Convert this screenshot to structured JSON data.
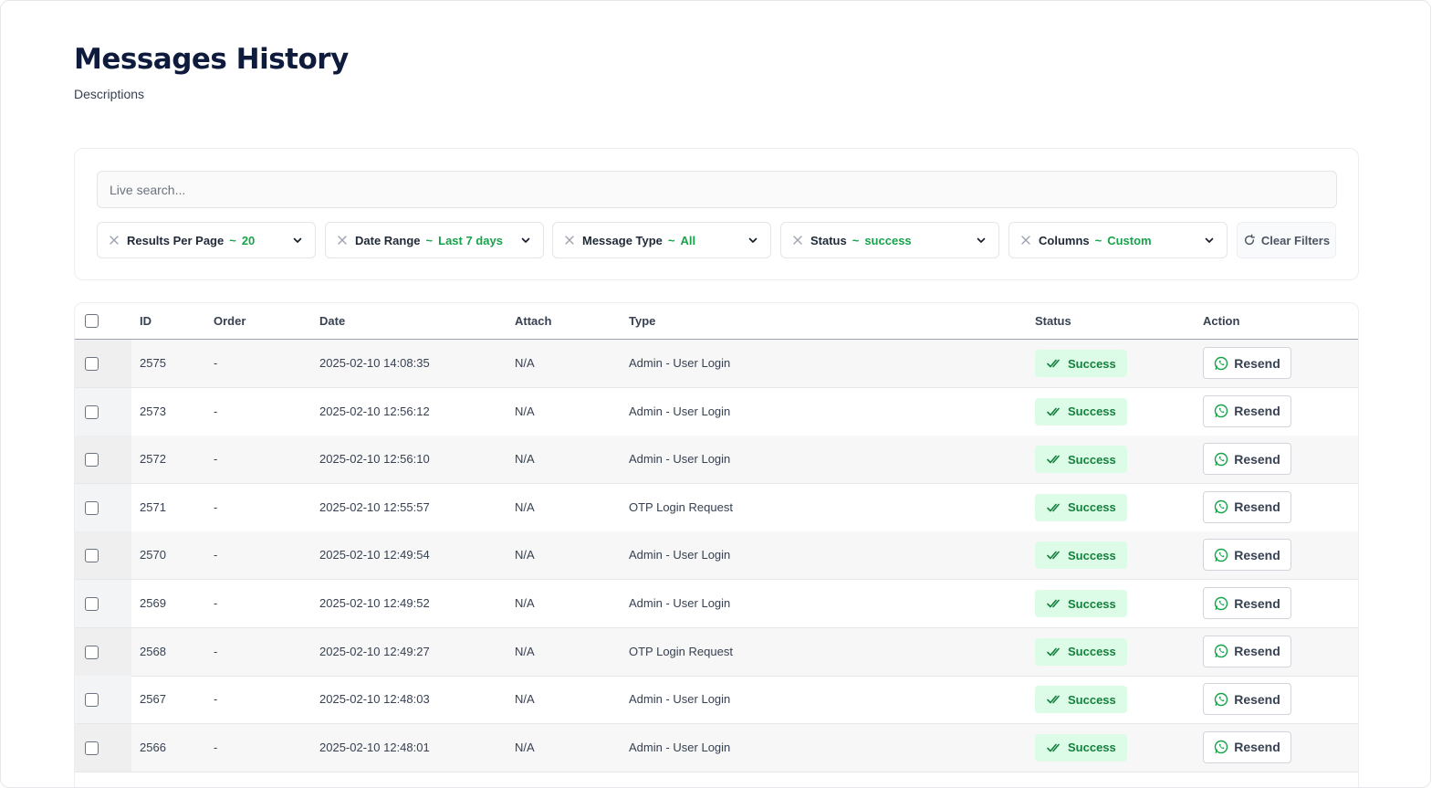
{
  "header": {
    "title": "Messages History",
    "description": "Descriptions"
  },
  "search": {
    "placeholder": "Live search..."
  },
  "filters": [
    {
      "label": "Results Per Page",
      "separator": "~",
      "value": "20"
    },
    {
      "label": "Date Range",
      "separator": "~",
      "value": "Last 7 days"
    },
    {
      "label": "Message Type",
      "separator": "~",
      "value": "All"
    },
    {
      "label": "Status",
      "separator": "~",
      "value": "success"
    },
    {
      "label": "Columns",
      "separator": "~",
      "value": "Custom"
    }
  ],
  "clear_filters_label": "Clear Filters",
  "table": {
    "columns": [
      "ID",
      "Order",
      "Date",
      "Attach",
      "Type",
      "Status",
      "Action"
    ],
    "rows": [
      {
        "id": "2575",
        "order": "-",
        "date": "2025-02-10 14:08:35",
        "attach": "N/A",
        "type": "Admin - User Login",
        "status": "Success",
        "action": "Resend"
      },
      {
        "id": "2573",
        "order": "-",
        "date": "2025-02-10 12:56:12",
        "attach": "N/A",
        "type": "Admin - User Login",
        "status": "Success",
        "action": "Resend"
      },
      {
        "id": "2572",
        "order": "-",
        "date": "2025-02-10 12:56:10",
        "attach": "N/A",
        "type": "Admin - User Login",
        "status": "Success",
        "action": "Resend"
      },
      {
        "id": "2571",
        "order": "-",
        "date": "2025-02-10 12:55:57",
        "attach": "N/A",
        "type": "OTP Login Request",
        "status": "Success",
        "action": "Resend"
      },
      {
        "id": "2570",
        "order": "-",
        "date": "2025-02-10 12:49:54",
        "attach": "N/A",
        "type": "Admin - User Login",
        "status": "Success",
        "action": "Resend"
      },
      {
        "id": "2569",
        "order": "-",
        "date": "2025-02-10 12:49:52",
        "attach": "N/A",
        "type": "Admin - User Login",
        "status": "Success",
        "action": "Resend"
      },
      {
        "id": "2568",
        "order": "-",
        "date": "2025-02-10 12:49:27",
        "attach": "N/A",
        "type": "OTP Login Request",
        "status": "Success",
        "action": "Resend"
      },
      {
        "id": "2567",
        "order": "-",
        "date": "2025-02-10 12:48:03",
        "attach": "N/A",
        "type": "Admin - User Login",
        "status": "Success",
        "action": "Resend"
      },
      {
        "id": "2566",
        "order": "-",
        "date": "2025-02-10 12:48:01",
        "attach": "N/A",
        "type": "Admin - User Login",
        "status": "Success",
        "action": "Resend"
      }
    ]
  },
  "icons": {
    "filter_remove": "close-icon",
    "filter_open": "chevron-down-icon",
    "clear": "refresh-icon",
    "status": "double-check-icon",
    "resend": "whatsapp-icon"
  },
  "colors": {
    "accent": "#16a34a",
    "title": "#0f1b3d",
    "badge_bg": "#dcfce7",
    "badge_text": "#15803d"
  }
}
